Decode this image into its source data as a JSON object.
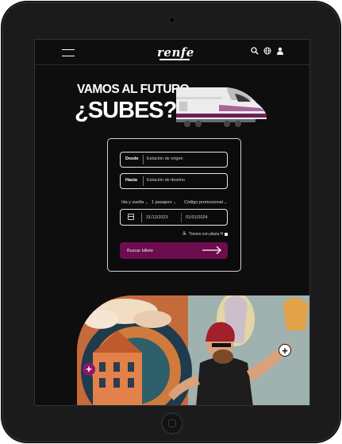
{
  "nav": {
    "logo": "renfe",
    "icons": [
      "menu-icon",
      "search-icon",
      "globe-icon",
      "user-icon"
    ]
  },
  "hero": {
    "line1": "VAMOS AL FUTURO.",
    "line2": "¿SUBES?"
  },
  "form": {
    "from_label": "Desde",
    "from_placeholder": "Estación de origen",
    "to_label": "Hasta",
    "to_placeholder": "Estación de destino",
    "trip_type": "Ida y vuelta",
    "passengers": "1 pasajero",
    "promo": "Código promocional",
    "date_out": "31/12/2023",
    "date_return": "01/01/2024",
    "h_trains": "Trenes con plaza H",
    "search_button": "Buscar billete"
  },
  "colors": {
    "brand": "#8d1669",
    "button": "#6d0c4e",
    "background": "#0e0e0e"
  }
}
